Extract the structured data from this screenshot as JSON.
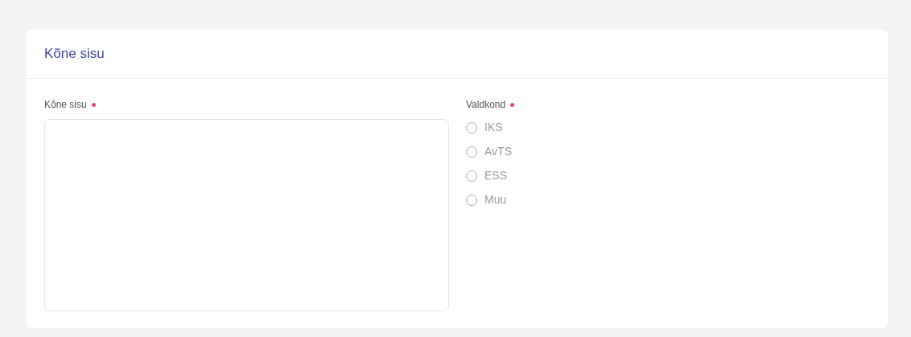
{
  "card": {
    "title": "Kõne sisu"
  },
  "text_field": {
    "label": "Kõne sisu",
    "required": true
  },
  "radio_group": {
    "label": "Valdkond",
    "required": true,
    "options": [
      {
        "label": "IKS",
        "selected": false
      },
      {
        "label": "AvTS",
        "selected": false
      },
      {
        "label": "ESS",
        "selected": false
      },
      {
        "label": "Muu",
        "selected": false
      }
    ]
  }
}
